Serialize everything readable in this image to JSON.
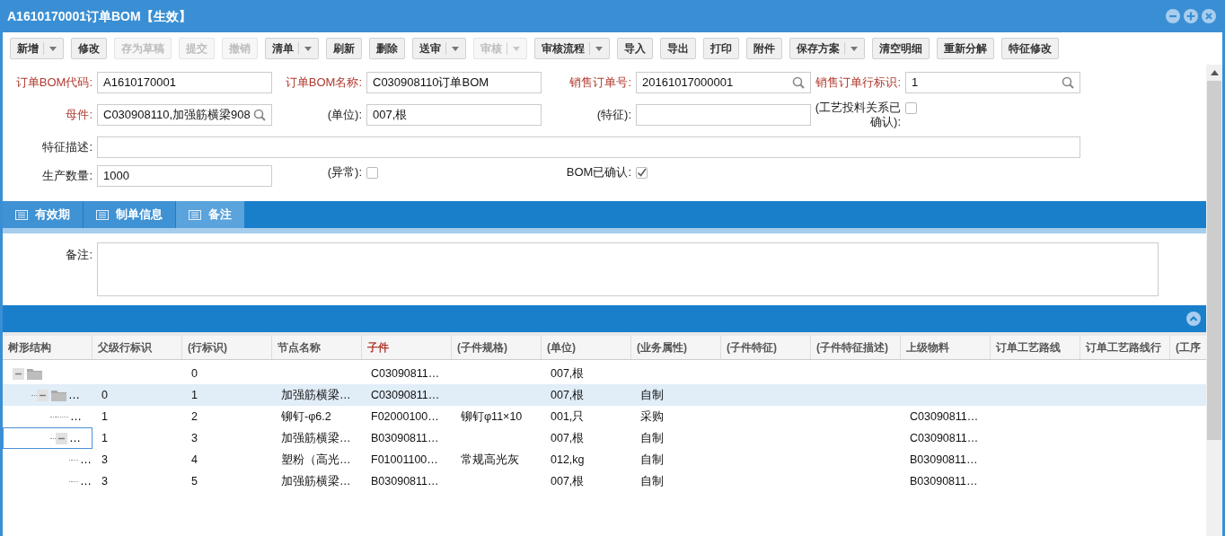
{
  "window": {
    "title": "A1610170001订单BOM【生效】"
  },
  "toolbar": [
    {
      "label": "新增",
      "disabled": false,
      "dropdown": true
    },
    {
      "label": "修改",
      "disabled": false,
      "dropdown": false
    },
    {
      "label": "存为草稿",
      "disabled": true,
      "dropdown": false
    },
    {
      "label": "提交",
      "disabled": true,
      "dropdown": false
    },
    {
      "label": "撤销",
      "disabled": true,
      "dropdown": false
    },
    {
      "label": "清单",
      "disabled": false,
      "dropdown": true
    },
    {
      "label": "刷新",
      "disabled": false,
      "dropdown": false
    },
    {
      "label": "删除",
      "disabled": false,
      "dropdown": false
    },
    {
      "label": "送审",
      "disabled": false,
      "dropdown": true
    },
    {
      "label": "审核",
      "disabled": true,
      "dropdown": true
    },
    {
      "label": "审核流程",
      "disabled": false,
      "dropdown": true
    },
    {
      "label": "导入",
      "disabled": false,
      "dropdown": false
    },
    {
      "label": "导出",
      "disabled": false,
      "dropdown": false
    },
    {
      "label": "打印",
      "disabled": false,
      "dropdown": false
    },
    {
      "label": "附件",
      "disabled": false,
      "dropdown": false
    },
    {
      "label": "保存方案",
      "disabled": false,
      "dropdown": true
    },
    {
      "label": "清空明细",
      "disabled": false,
      "dropdown": false
    },
    {
      "label": "重新分解",
      "disabled": false,
      "dropdown": false
    },
    {
      "label": "特征修改",
      "disabled": false,
      "dropdown": false
    }
  ],
  "form": [
    [
      {
        "label": "订单BOM代码:",
        "kind": "text",
        "required": true,
        "value": "A1610170001"
      },
      {
        "label": "订单BOM名称:",
        "kind": "text",
        "required": true,
        "value": "C030908110订单BOM"
      },
      {
        "label": "销售订单号:",
        "kind": "search",
        "required": true,
        "value": "20161017000001"
      },
      {
        "label": "销售订单行标识:",
        "kind": "search",
        "required": true,
        "value": "1"
      }
    ],
    [
      {
        "label": "母件:",
        "kind": "search",
        "required": true,
        "value": "C030908110,加强筋横梁908"
      },
      {
        "label": "(单位):",
        "kind": "text",
        "required": false,
        "value": "007,根"
      },
      {
        "label": "(特征):",
        "kind": "text",
        "required": false
      },
      {
        "label": "(工艺投料关系已确认):",
        "kind": "checkbox",
        "required": false,
        "checked": false
      }
    ],
    [
      {
        "label": "特征描述:",
        "kind": "wide",
        "required": false
      }
    ],
    [
      {
        "label": "生产数量:",
        "kind": "text",
        "required": false,
        "value": "1000"
      },
      {
        "label": "(异常):",
        "kind": "checkbox",
        "required": false,
        "checked": false
      },
      {
        "label": "BOM已确认:",
        "kind": "checkbox",
        "required": false,
        "checked": true
      }
    ]
  ],
  "tabs": [
    {
      "label": "有效期",
      "selected": false
    },
    {
      "label": "制单信息",
      "selected": false
    },
    {
      "label": "备注",
      "selected": true
    }
  ],
  "remark": {
    "label": "备注:"
  },
  "table": {
    "columns": [
      {
        "label": "树形结构",
        "required": false
      },
      {
        "label": "父级行标识",
        "required": false
      },
      {
        "label": "(行标识)",
        "required": false
      },
      {
        "label": "节点名称",
        "required": false
      },
      {
        "label": "子件",
        "required": true
      },
      {
        "label": "(子件规格)",
        "required": false
      },
      {
        "label": "(单位)",
        "required": false
      },
      {
        "label": "(业务属性)",
        "required": false
      },
      {
        "label": "(子件特征)",
        "required": false
      },
      {
        "label": "(子件特征描述)",
        "required": false
      },
      {
        "label": "上级物料",
        "required": false
      },
      {
        "label": "订单工艺路线",
        "required": false
      },
      {
        "label": "订单工艺路线行",
        "required": false
      },
      {
        "label": "(工序",
        "required": false
      }
    ],
    "rows": [
      {
        "kind": "folder",
        "selected": false,
        "focused": false,
        "cells": [
          "",
          "",
          "0",
          "",
          "C03090811…",
          "",
          "007,根",
          "",
          "",
          "",
          "",
          "",
          "",
          ""
        ],
        "children": [
          {
            "kind": "folder",
            "selected": true,
            "focused": false,
            "cells": [
              "…",
              "0",
              "1",
              "加强筋横梁…",
              "C03090811…",
              "",
              "007,根",
              "自制",
              "",
              "",
              "",
              "",
              "",
              ""
            ],
            "children": [
              {
                "kind": "leaf",
                "selected": false,
                "focused": false,
                "cells": [
                  "…",
                  "1",
                  "2",
                  "铆钉-φ6.2",
                  "F02000100…",
                  "铆钉φ11×10",
                  "001,只",
                  "采购",
                  "",
                  "",
                  "C03090811…",
                  "",
                  "",
                  ""
                ]
              },
              {
                "kind": "folder",
                "selected": false,
                "focused": true,
                "cells": [
                  "…",
                  "1",
                  "3",
                  "加强筋横梁…",
                  "B03090811…",
                  "",
                  "007,根",
                  "自制",
                  "",
                  "",
                  "C03090811…",
                  "",
                  "",
                  ""
                ],
                "children": [
                  {
                    "kind": "leaf",
                    "selected": false,
                    "focused": false,
                    "cells": [
                      "…",
                      "3",
                      "4",
                      "塑粉（高光…",
                      "F01001100…",
                      "常规高光灰",
                      "012,kg",
                      "自制",
                      "",
                      "",
                      "B03090811…",
                      "",
                      "",
                      ""
                    ]
                  },
                  {
                    "kind": "leaf",
                    "selected": false,
                    "focused": false,
                    "cells": [
                      "…",
                      "3",
                      "5",
                      "加强筋横梁…",
                      "B03090811…",
                      "",
                      "007,根",
                      "自制",
                      "",
                      "",
                      "B03090811…",
                      "",
                      "",
                      ""
                    ]
                  }
                ]
              }
            ]
          }
        ]
      }
    ]
  }
}
